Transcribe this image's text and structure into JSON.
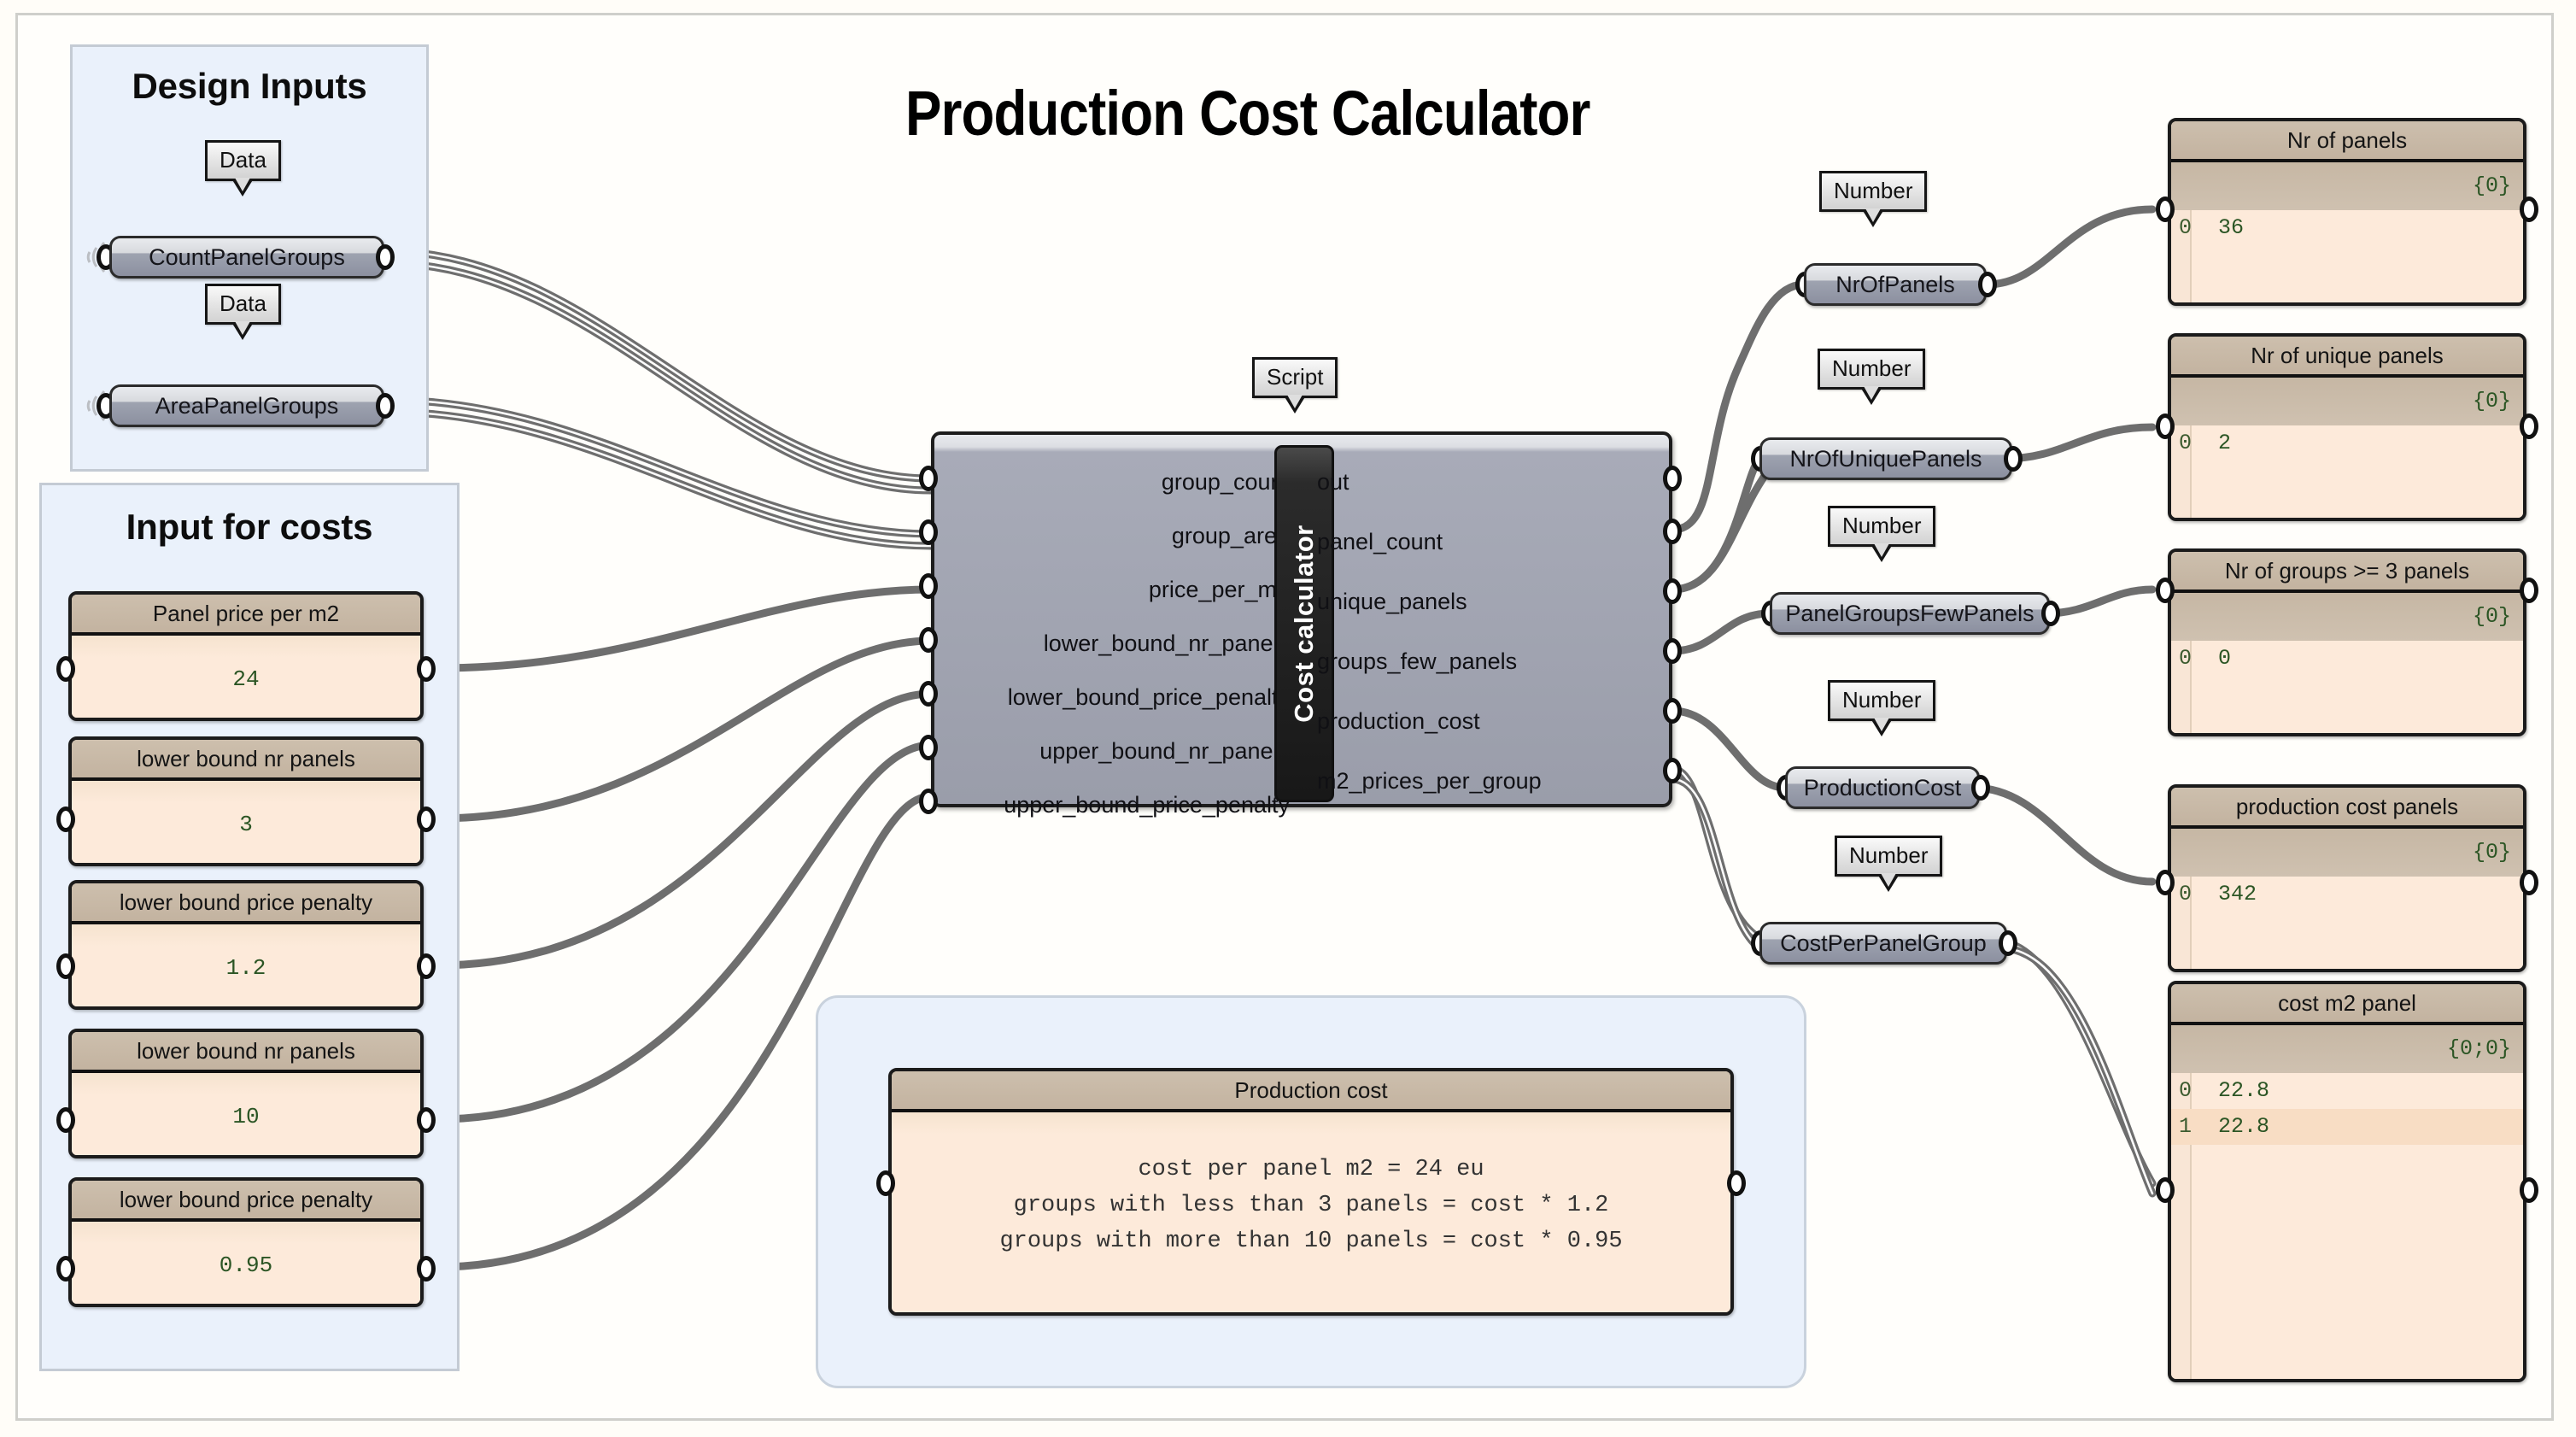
{
  "title": "Production Cost Calculator",
  "groups": [
    {
      "name": "design-inputs",
      "label": "Design Inputs"
    },
    {
      "name": "input-for-costs",
      "label": "Input for costs"
    },
    {
      "name": "note-group",
      "label": ""
    }
  ],
  "balloons": {
    "data": "Data",
    "number": "Number",
    "script": "Script"
  },
  "design_inputs": {
    "heading": "Design Inputs",
    "nodes": [
      {
        "label": "CountPanelGroups",
        "tag": "Data"
      },
      {
        "label": "AreaPanelGroups",
        "tag": "Data"
      }
    ]
  },
  "input_for_costs": {
    "heading": "Input for costs",
    "panels": [
      {
        "title": "Panel price per m2",
        "value": "24"
      },
      {
        "title": "lower bound nr panels",
        "value": "3"
      },
      {
        "title": "lower bound price penalty",
        "value": "1.2"
      },
      {
        "title": "lower bound nr panels",
        "value": "10"
      },
      {
        "title": "lower bound price penalty",
        "value": "0.95"
      }
    ]
  },
  "script_component": {
    "tag": "Script",
    "name": "Cost calculator",
    "inputs": [
      "group_count",
      "group_area",
      "price_per_m2",
      "lower_bound_nr_panels",
      "lower_bound_price_penalty",
      "upper_bound_nr_panels",
      "upper_bound_price_penalty"
    ],
    "outputs": [
      "out",
      "panel_count",
      "unique_panels",
      "groups_few_panels",
      "production_cost",
      "m2_prices_per_group"
    ]
  },
  "parameter_nodes": [
    {
      "label": "NrOfPanels",
      "tag": "Number"
    },
    {
      "label": "NrOfUniquePanels",
      "tag": "Number"
    },
    {
      "label": "PanelGroupsFewPanels",
      "tag": "Number"
    },
    {
      "label": "ProductionCost",
      "tag": "Number"
    },
    {
      "label": "CostPerPanelGroup",
      "tag": "Number"
    }
  ],
  "output_panels": [
    {
      "title": "Nr of panels",
      "path": "{0}",
      "rows": [
        {
          "index": "0",
          "value": "36"
        }
      ]
    },
    {
      "title": "Nr of unique panels",
      "path": "{0}",
      "rows": [
        {
          "index": "0",
          "value": "2"
        }
      ]
    },
    {
      "title": "Nr of groups >= 3 panels",
      "path": "{0}",
      "rows": [
        {
          "index": "0",
          "value": "0"
        }
      ]
    },
    {
      "title": "production cost panels",
      "path": "{0}",
      "rows": [
        {
          "index": "0",
          "value": "342"
        }
      ]
    },
    {
      "title": "cost m2 panel",
      "path": "{0;0}",
      "rows": [
        {
          "index": "0",
          "value": "22.8"
        },
        {
          "index": "1",
          "value": "22.8"
        }
      ]
    }
  ],
  "note_panel": {
    "title": "Production cost",
    "lines": [
      "cost per panel m2 = 24 eu",
      "groups with less than 3 panels = cost * 1.2",
      "groups with more than 10 panels = cost * 0.95"
    ]
  },
  "colors": {
    "canvas": "#fffefb",
    "group_fill": "#eaf1fb",
    "group_border": "#c4cbd4",
    "panel_header": "#c6b7a4",
    "panel_body": "#fdeada",
    "value_text": "#2b5524",
    "wire": "#6e6e6e",
    "component_body": "#9a9daa",
    "namebar": "#181818"
  }
}
